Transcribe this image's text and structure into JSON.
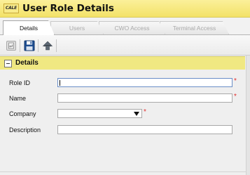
{
  "header": {
    "logo_text": "CALE",
    "title": "User Role Details"
  },
  "tabs": [
    {
      "label": "Details",
      "active": true
    },
    {
      "label": "Users",
      "active": false
    },
    {
      "label": "CWO Access",
      "active": false
    },
    {
      "label": "Terminal Access",
      "active": false
    }
  ],
  "toolbar": {
    "icons": [
      "undo-icon",
      "save-icon",
      "navigate-up-icon"
    ]
  },
  "section": {
    "title": "Details",
    "collapse_symbol": "collapse-icon"
  },
  "form": {
    "role_id": {
      "label": "Role ID",
      "value": "",
      "required": true
    },
    "name": {
      "label": "Name",
      "value": "",
      "required": true
    },
    "company": {
      "label": "Company",
      "value": "",
      "required": true
    },
    "description": {
      "label": "Description",
      "value": "",
      "required": false
    },
    "required_marker": "*"
  },
  "colors": {
    "header_yellow": "#f3e268",
    "section_yellow": "#f0e882",
    "required_red": "#e23030",
    "focus_border": "#6a8ec7"
  }
}
